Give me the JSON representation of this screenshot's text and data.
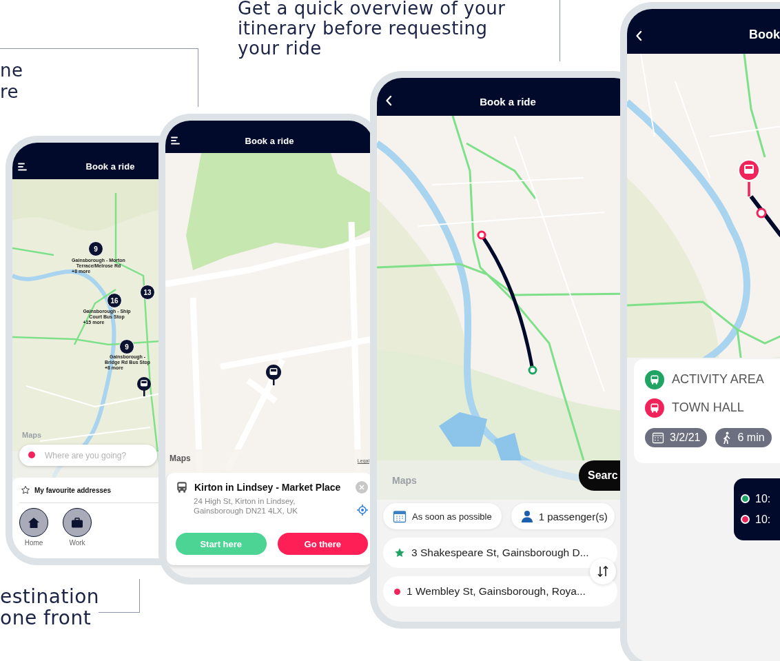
{
  "captions": [
    {
      "text": "ne\nre"
    },
    {
      "text": "Get a quick overview of your\nitinerary before requesting\nyour ride"
    },
    {
      "text": "estination\none front"
    }
  ],
  "phones": [
    {
      "kind": "stops_map",
      "header": {
        "title": "Book a ride",
        "menu": true
      },
      "map_credit": "Maps",
      "pins": [
        {
          "count": "9",
          "label": "Gainsborough - Morton\nTerrace/Melrose Rd",
          "more": "+8 more"
        },
        {
          "count": "16",
          "label": "Gainsborough - Ship\nCourt Bus Stop",
          "more": "+15 more"
        },
        {
          "count": "13"
        },
        {
          "count": "9",
          "label": "Gainsborough -\nBridge Rd Bus Stop",
          "more": "+8 more"
        }
      ],
      "search": {
        "placeholder": "Where are you going?"
      },
      "favourites": {
        "title": "My favourite addresses",
        "items": [
          {
            "kind": "home",
            "label": "Home"
          },
          {
            "kind": "work",
            "label": "Work"
          }
        ]
      }
    },
    {
      "kind": "place_card",
      "header": {
        "title": "Book a ride",
        "menu": true
      },
      "map_credit": "Maps",
      "legal": "Legal",
      "place": {
        "name": "Kirton in Lindsey - Market Place",
        "address": "24 High St, Kirton in Lindsey,\nGainsborough DN21 4LX, UK"
      },
      "buttons": [
        {
          "kind": "start",
          "label": "Start here"
        },
        {
          "kind": "go",
          "label": "Go there"
        }
      ]
    },
    {
      "kind": "route_search",
      "header": {
        "title": "Book a ride",
        "back": true
      },
      "map_credit": "Maps",
      "search_button": "Searc",
      "when": "As soon as possible",
      "passengers": "1 passenger(s)",
      "origin": "3 Shakespeare St, Gainsborough D...",
      "destination": "1 Wembley St, Gainsborough, Roya..."
    },
    {
      "kind": "trip_summary",
      "header": {
        "title": "Book",
        "back": true
      },
      "stops": [
        {
          "name": "ACTIVITY AREA",
          "color": "#1fa463"
        },
        {
          "name": "TOWN HALL",
          "color": "#f0245a"
        }
      ],
      "date": "3/2/21",
      "walk": "6 min",
      "times": [
        {
          "text": "10:",
          "color": "#1fa463"
        },
        {
          "text": "10:",
          "color": "#f0245a"
        }
      ]
    }
  ]
}
